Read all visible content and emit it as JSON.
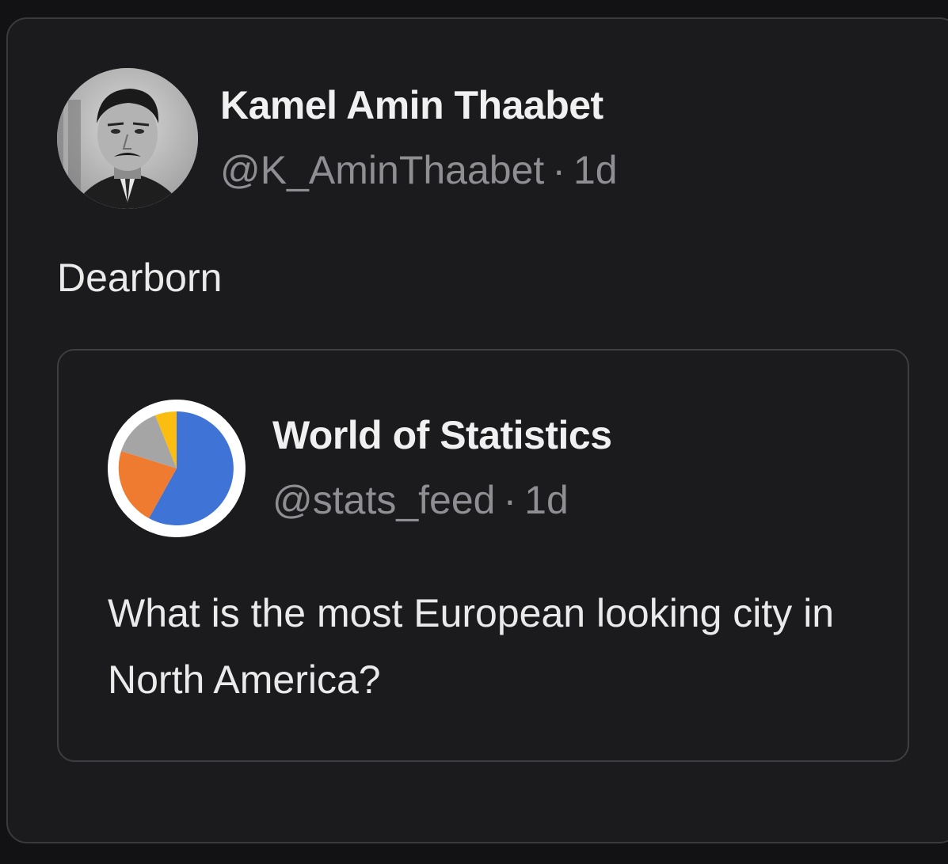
{
  "post": {
    "author_name": "Kamel Amin Thaabet",
    "author_handle": "@K_AminThaabet",
    "separator": "·",
    "time": "1d",
    "avatar_icon": "profile-photo",
    "text": "Dearborn"
  },
  "quoted_post": {
    "author_name": "World of Statistics",
    "author_handle": "@stats_feed",
    "separator": "·",
    "time": "1d",
    "avatar_icon": "pie-chart-logo",
    "text": "What is the most European looking city in North America?"
  },
  "colors": {
    "background": "#121214",
    "card": "#1b1b1d",
    "pie_blue": "#3f74d6",
    "pie_orange": "#ee7b2f",
    "pie_gray": "#a5a5a5",
    "pie_yellow": "#fbbd10"
  }
}
